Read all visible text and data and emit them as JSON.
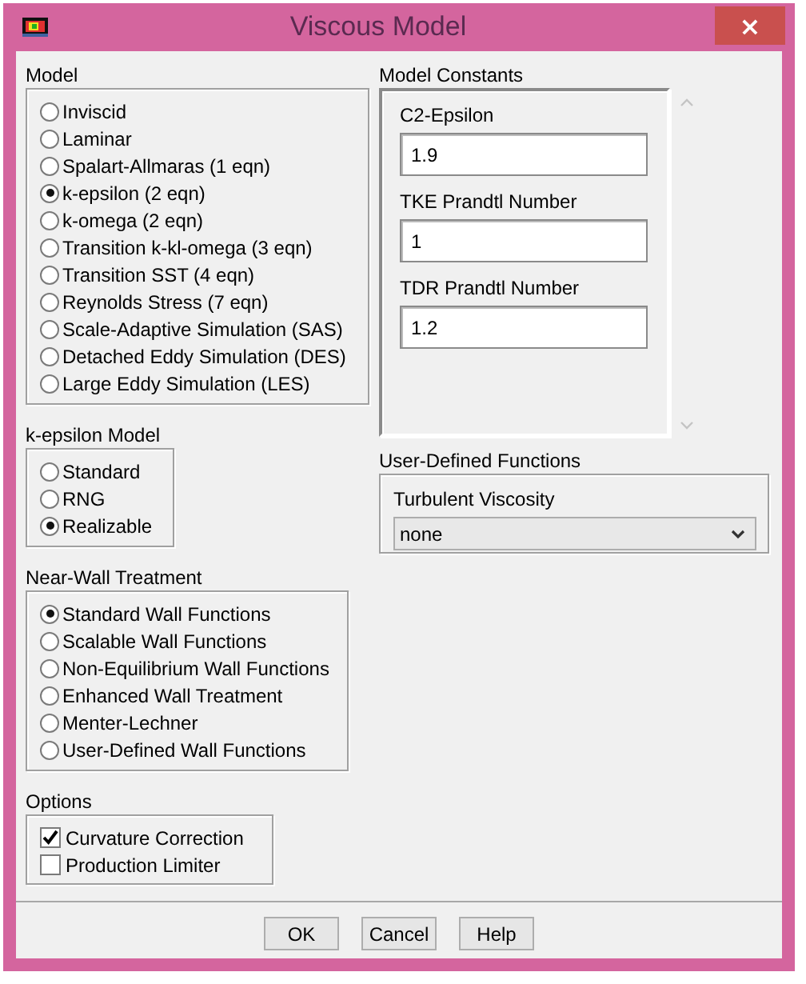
{
  "window": {
    "title": "Viscous Model",
    "close": "×"
  },
  "model": {
    "label": "Model",
    "options": [
      {
        "label": "Inviscid",
        "selected": false
      },
      {
        "label": "Laminar",
        "selected": false
      },
      {
        "label": "Spalart-Allmaras (1 eqn)",
        "selected": false
      },
      {
        "label": "k-epsilon (2 eqn)",
        "selected": true
      },
      {
        "label": "k-omega (2 eqn)",
        "selected": false
      },
      {
        "label": "Transition k-kl-omega (3 eqn)",
        "selected": false
      },
      {
        "label": "Transition SST (4 eqn)",
        "selected": false
      },
      {
        "label": "Reynolds Stress (7 eqn)",
        "selected": false
      },
      {
        "label": "Scale-Adaptive Simulation (SAS)",
        "selected": false
      },
      {
        "label": "Detached Eddy Simulation (DES)",
        "selected": false
      },
      {
        "label": "Large Eddy Simulation (LES)",
        "selected": false
      }
    ]
  },
  "k_epsilon_model": {
    "label": "k-epsilon Model",
    "options": [
      {
        "label": "Standard",
        "selected": false
      },
      {
        "label": "RNG",
        "selected": false
      },
      {
        "label": "Realizable",
        "selected": true
      }
    ]
  },
  "near_wall_treatment": {
    "label": "Near-Wall Treatment",
    "options": [
      {
        "label": "Standard Wall Functions",
        "selected": true
      },
      {
        "label": "Scalable Wall Functions",
        "selected": false
      },
      {
        "label": "Non-Equilibrium Wall Functions",
        "selected": false
      },
      {
        "label": "Enhanced Wall Treatment",
        "selected": false
      },
      {
        "label": "Menter-Lechner",
        "selected": false
      },
      {
        "label": "User-Defined Wall Functions",
        "selected": false
      }
    ]
  },
  "options": {
    "label": "Options",
    "items": [
      {
        "label": "Curvature Correction",
        "checked": true
      },
      {
        "label": "Production Limiter",
        "checked": false
      }
    ]
  },
  "model_constants": {
    "label": "Model Constants",
    "fields": [
      {
        "label": "C2-Epsilon",
        "value": "1.9"
      },
      {
        "label": "TKE Prandtl Number",
        "value": "1"
      },
      {
        "label": "TDR Prandtl Number",
        "value": "1.2"
      }
    ]
  },
  "user_defined_functions": {
    "label": "User-Defined Functions",
    "fields": [
      {
        "label": "Turbulent Viscosity",
        "value": "none"
      }
    ]
  },
  "buttons": [
    "OK",
    "Cancel",
    "Help"
  ]
}
